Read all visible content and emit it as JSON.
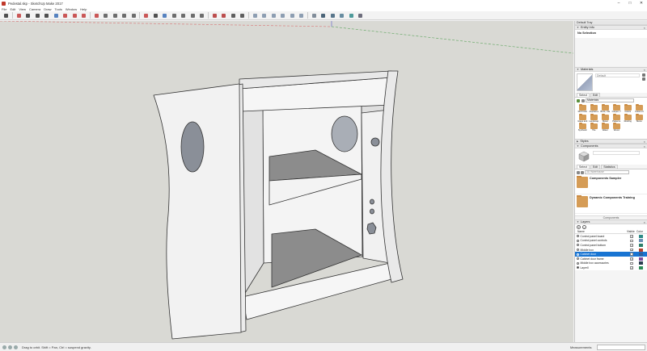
{
  "window": {
    "title": "Pedestal.skp - SketchUp Make 2017",
    "min": "–",
    "max": "□",
    "close": "✕"
  },
  "menu": [
    "File",
    "Edit",
    "View",
    "Camera",
    "Draw",
    "Tools",
    "Window",
    "Help"
  ],
  "toolbar": {
    "tools": [
      "select-icon",
      "eraser-icon",
      "line-icon",
      "arc-icon",
      "rectangle-icon",
      "push-pull-icon",
      "move-icon",
      "rotate-icon",
      "scale-icon",
      "offset-icon",
      "tape-measure-icon",
      "dimension-icon",
      "protractor-icon",
      "text-icon",
      "axes-icon",
      "3d-text-icon",
      "orbit-icon",
      "pan-icon",
      "zoom-icon",
      "zoom-window-icon",
      "zoom-extents-icon",
      "warehouse-icon",
      "extension-warehouse-icon",
      "layout-icon",
      "extension-manager-icon",
      "iso-view-icon",
      "top-view-icon",
      "front-view-icon",
      "right-view-icon",
      "back-view-icon",
      "left-view-icon",
      "xray-icon",
      "wireframe-icon",
      "hidden-line-icon",
      "shaded-icon",
      "shaded-textures-icon",
      "monochrome-icon"
    ]
  },
  "status": {
    "hint": "Drag to orbit. Shift = Pan, Ctrl = suspend gravity.",
    "measurements_label": "Measurements"
  },
  "tray": {
    "title": "Default Tray",
    "entity_info": {
      "header": "Entity Info",
      "value": "No Selection"
    },
    "materials": {
      "header": "Materials",
      "name": "Default",
      "tabs": [
        "Select",
        "Edit"
      ],
      "library": "Materials",
      "items": [
        "3D Printin",
        "Asphalt a",
        "Brick, Cla",
        "Carpet, T",
        "Colors",
        "Colors-N",
        "Glass and",
        "Landscap",
        "Metal",
        "Patterns",
        "Roofing",
        "Stone",
        "Synthetic",
        "Tile",
        "Water",
        "Wood"
      ]
    },
    "styles": {
      "header": "Styles"
    },
    "components": {
      "header": "Components",
      "tabs": [
        "Select",
        "Edit",
        "Statistics"
      ],
      "search_placeholder": "3D Warehouse",
      "items": [
        "Components Sampler",
        "Dynamic Components Training"
      ],
      "footer": "Components"
    },
    "layers": {
      "header": "Layers",
      "add": "+",
      "remove": "–",
      "columns": [
        "Name",
        "Visible",
        "Color"
      ],
      "rows": [
        {
          "name": "Control panel board",
          "visible": true,
          "color": "#2e8b86",
          "selected": false,
          "active": false
        },
        {
          "name": "Control panel controls",
          "visible": false,
          "color": "#6a8fb4",
          "selected": false,
          "active": false
        },
        {
          "name": "Control panel bottom",
          "visible": true,
          "color": "#2c7f6a",
          "selected": false,
          "active": false
        },
        {
          "name": "Middle box",
          "visible": true,
          "color": "#b3402e",
          "selected": false,
          "active": false
        },
        {
          "name": "Cabinet door",
          "visible": false,
          "color": "#2e5f9a",
          "selected": true,
          "active": false
        },
        {
          "name": "Cabinet door frame",
          "visible": true,
          "color": "#7a4a9c",
          "selected": false,
          "active": false
        },
        {
          "name": "Middle box accessories",
          "visible": false,
          "color": "#2c3e50",
          "selected": false,
          "active": false
        },
        {
          "name": "Layer0",
          "visible": true,
          "color": "#2e8b57",
          "selected": false,
          "active": true
        }
      ]
    }
  },
  "check": "✓"
}
